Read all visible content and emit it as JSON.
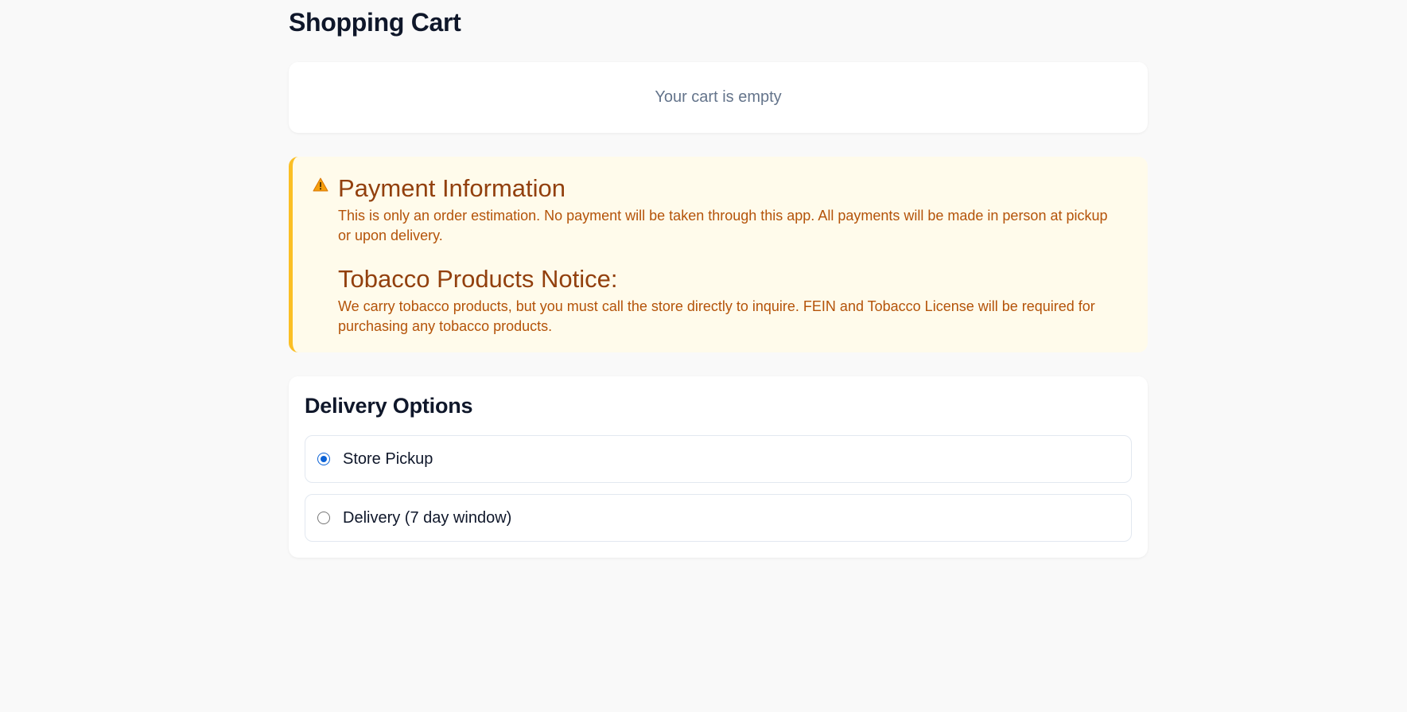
{
  "page": {
    "title": "Shopping Cart"
  },
  "cart": {
    "empty_message": "Your cart is empty"
  },
  "notice": {
    "icon": "warning-icon",
    "payment_title": "Payment Information",
    "payment_text": "This is only an order estimation. No payment will be taken through this app. All payments will be made in person at pickup or upon delivery.",
    "tobacco_title": "Tobacco Products Notice:",
    "tobacco_text": "We carry tobacco products, but you must call the store directly to inquire. FEIN and Tobacco License will be required for purchasing any tobacco products.",
    "colors": {
      "background": "#fffbeb",
      "border": "#fbbf24",
      "title": "#92400e",
      "text": "#b45309"
    }
  },
  "delivery": {
    "title": "Delivery Options",
    "options": [
      {
        "label": "Store Pickup",
        "selected": true
      },
      {
        "label": "Delivery (7 day window)",
        "selected": false
      }
    ],
    "accent_color": "#0b62d6"
  }
}
